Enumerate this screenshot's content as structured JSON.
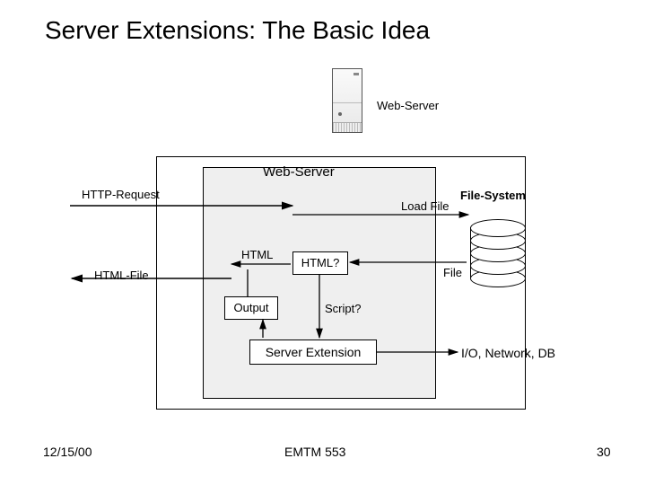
{
  "title": "Server Extensions: The Basic Idea",
  "labels": {
    "web_server_1": "Web-Server",
    "web_server_2": "Web-Server",
    "http_request": "HTTP-Request",
    "load_file": "Load File",
    "file_system": "File-System",
    "html": "HTML",
    "html_file": "HTML-File",
    "output": "Output",
    "htmlq": "HTML?",
    "scriptq": "Script?",
    "file": "File",
    "server_extension": "Server Extension",
    "io_net_db": "I/O, Network, DB"
  },
  "footer": {
    "date": "12/15/00",
    "course": "EMTM 553",
    "page": "30"
  }
}
